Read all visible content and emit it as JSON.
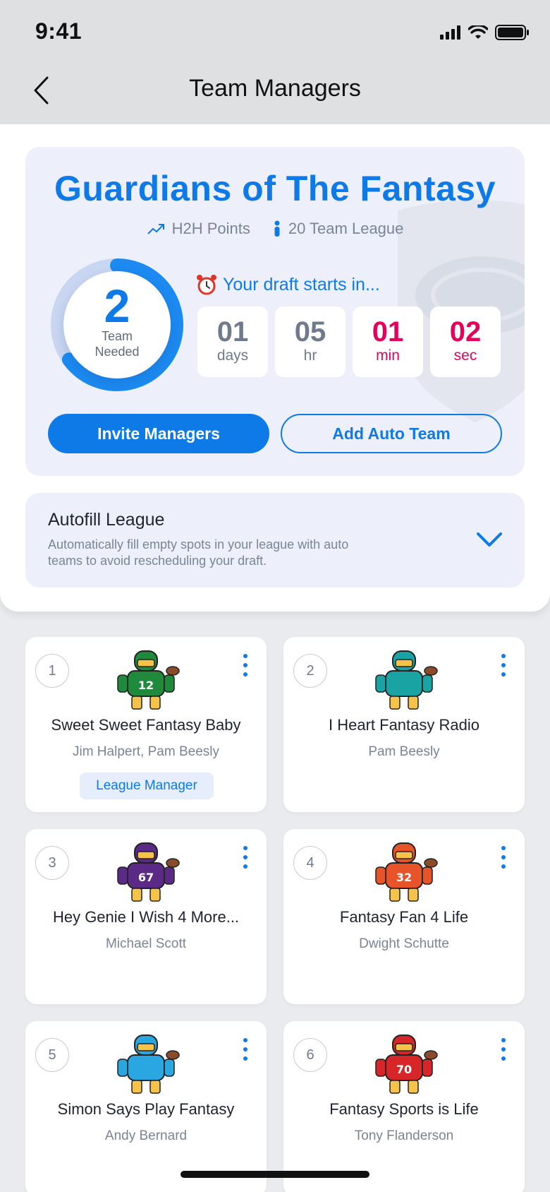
{
  "status_bar": {
    "time": "9:41"
  },
  "nav": {
    "title": "Team Managers"
  },
  "league": {
    "name": "Guardians of The Fantasy",
    "scoring": "H2H Points",
    "size": "20 Team League",
    "teams_needed": "2",
    "teams_needed_label_1": "Team",
    "teams_needed_label_2": "Needed",
    "teams_filled_fraction": 0.65,
    "draft_text": "Your draft starts in...",
    "countdown": [
      {
        "value": "01",
        "unit": "days"
      },
      {
        "value": "05",
        "unit": "hr"
      },
      {
        "value": "01",
        "unit": "min"
      },
      {
        "value": "02",
        "unit": "sec"
      }
    ],
    "invite_label": "Invite Managers",
    "auto_team_label": "Add Auto Team"
  },
  "autofill": {
    "title": "Autofill League",
    "description": "Automatically fill empty spots in your league with auto teams to avoid rescheduling your draft."
  },
  "teams": [
    {
      "number": "1",
      "name": "Sweet Sweet Fantasy Baby",
      "owners": "Jim Halpert, Pam Beesly",
      "badge": "League Manager",
      "jersey": "12",
      "jersey_color": "#1f8a3b"
    },
    {
      "number": "2",
      "name": "I Heart Fantasy Radio",
      "owners": "Pam Beesly",
      "jersey": "",
      "jersey_color": "#1aa3a3"
    },
    {
      "number": "3",
      "name": "Hey Genie I Wish 4 More...",
      "owners": "Michael Scott",
      "jersey": "67",
      "jersey_color": "#5b2a86"
    },
    {
      "number": "4",
      "name": "Fantasy Fan 4 Life",
      "owners": "Dwight Schutte",
      "jersey": "32",
      "jersey_color": "#e8542a"
    },
    {
      "number": "5",
      "name": "Simon Says Play Fantasy",
      "owners": "Andy Bernard",
      "jersey": "",
      "jersey_color": "#2aa7e0"
    },
    {
      "number": "6",
      "name": "Fantasy Sports is Life",
      "owners": "Tony Flanderson",
      "jersey": "70",
      "jersey_color": "#d7262a"
    }
  ],
  "colors": {
    "accent": "#0d7ae8",
    "alert": "#e6005c"
  }
}
